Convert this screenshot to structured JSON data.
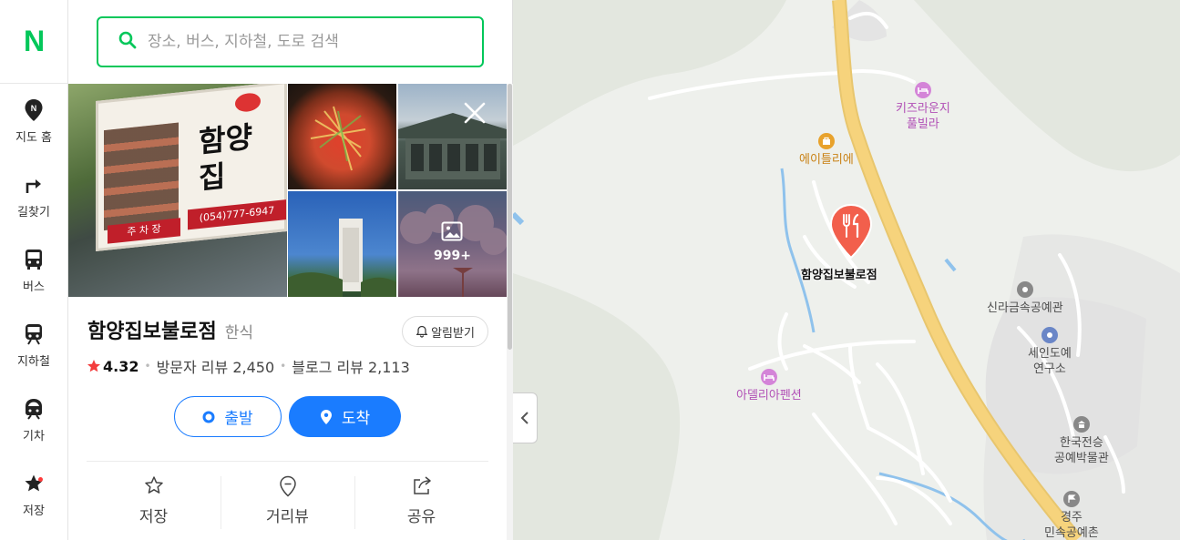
{
  "rail": {
    "logo": "N",
    "items": [
      {
        "label": "지도 홈",
        "icon": "map-pin-n-icon"
      },
      {
        "label": "길찾기",
        "icon": "turn-right-arrow-icon"
      },
      {
        "label": "버스",
        "icon": "bus-icon"
      },
      {
        "label": "지하철",
        "icon": "subway-icon"
      },
      {
        "label": "기차",
        "icon": "train-icon"
      },
      {
        "label": "저장",
        "icon": "star-icon"
      }
    ]
  },
  "search": {
    "placeholder": "장소, 버스, 지하철, 도로 검색",
    "value": ""
  },
  "place": {
    "photo_sign_tel": "(054)777-6947",
    "photo_sign_name": "함양집",
    "photo_sign_parking": "주 차 장",
    "photo_more_count": "999+",
    "name": "함양집보불로점",
    "category": "한식",
    "alarm_label": "알림받기",
    "rating": "4.32",
    "visitor_reviews": "방문자 리뷰 2,450",
    "blog_reviews": "블로그 리뷰 2,113",
    "start_label": "출발",
    "arrive_label": "도착",
    "actions": [
      {
        "label": "저장",
        "icon": "star-outline-icon"
      },
      {
        "label": "거리뷰",
        "icon": "street-view-pin-icon"
      },
      {
        "label": "공유",
        "icon": "share-icon"
      }
    ]
  },
  "map": {
    "pin_label": "함양집보불로점",
    "pois": [
      {
        "id": "kids",
        "label1": "키즈라운지",
        "label2": "풀빌라"
      },
      {
        "id": "atelier",
        "label1": "에이틀리에"
      },
      {
        "id": "silla",
        "label1": "신라금속공예관"
      },
      {
        "id": "sein",
        "label1": "세인도예",
        "label2": "연구소"
      },
      {
        "id": "adelia",
        "label1": "아델리아펜션"
      },
      {
        "id": "museum",
        "label1": "한국전승",
        "label2": "공예박물관"
      },
      {
        "id": "village",
        "label1": "경주",
        "label2": "민속공예촌"
      }
    ],
    "colors": {
      "road_main": "#f6d37c",
      "road_minor": "#ffffff",
      "water": "#8fc2ec",
      "green_dark": "#e1e6dc",
      "urban": "#e4e4e4",
      "pin": "#f25f4c"
    }
  }
}
